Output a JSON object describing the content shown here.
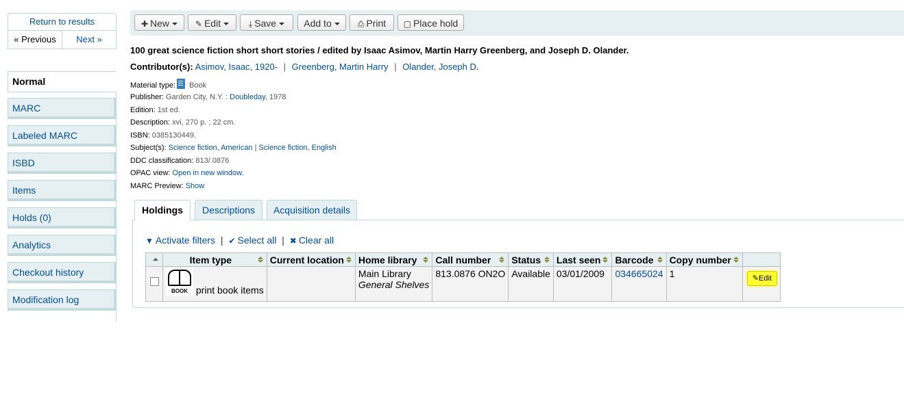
{
  "nav": {
    "return": "Return to results",
    "previous": "« Previous",
    "next": "Next »"
  },
  "sidebar": {
    "items": [
      {
        "label": "Normal"
      },
      {
        "label": "MARC"
      },
      {
        "label": "Labeled MARC"
      },
      {
        "label": "ISBD"
      },
      {
        "label": "Items"
      },
      {
        "label": "Holds (0)"
      },
      {
        "label": "Analytics"
      },
      {
        "label": "Checkout history"
      },
      {
        "label": "Modification log"
      }
    ]
  },
  "toolbar": {
    "new": "New",
    "edit": "Edit",
    "save": "Save",
    "add_to": "Add to",
    "print": "Print",
    "place_hold": "Place hold"
  },
  "record": {
    "title": "100 great science fiction short short stories / edited by Isaac Asimov, Martin Harry Greenberg, and Joseph D. Olander.",
    "contributors_label": "Contributor(s):",
    "contributors": [
      "Asimov, Isaac, 1920-",
      "Greenberg, Martin Harry",
      "Olander, Joseph D"
    ],
    "contributors_end": ".",
    "sep": "|",
    "material_type_label": "Material type:",
    "material_type": "Book",
    "publisher_label": "Publisher:",
    "publisher_place": "Garden City, N.Y. :",
    "publisher_name": "Doubleday",
    "publisher_year": ", 1978",
    "edition_label": "Edition:",
    "edition": "1st ed.",
    "description_label": "Description:",
    "description": "xvi, 270 p. ; 22 cm.",
    "isbn_label": "ISBN:",
    "isbn": "0385130449.",
    "subjects_label": "Subject(s):",
    "subject1a": "Science fiction",
    "subject1b": "American",
    "subject2a": "Science fiction",
    "subject2b": "English",
    "comma": ",",
    "ddc_label": "DDC classification:",
    "ddc": "813/.0876",
    "opac_label": "OPAC view:",
    "opac": "Open in new window.",
    "marc_preview_label": "MARC Preview:",
    "marc_preview": "Show"
  },
  "tabs": {
    "holdings": "Holdings",
    "descriptions": "Descriptions",
    "acquisition": "Acquisition details"
  },
  "filters": {
    "activate": "Activate filters",
    "select_all": "Select all",
    "clear_all": "Clear all",
    "pipe": "|"
  },
  "table": {
    "headers": [
      "Item type",
      "Current location",
      "Home library",
      "Call number",
      "Status",
      "Last seen",
      "Barcode",
      "Copy number"
    ],
    "row": {
      "item_type_icon_caption": "BOOK",
      "item_type": "print book items",
      "current_location": "",
      "home_library": "Main Library",
      "shelving": "General Shelves",
      "call_number": "813.0876 ON2O",
      "status": "Available",
      "last_seen": "03/01/2009",
      "barcode": "034665024",
      "copy_number": "1",
      "edit": "Edit"
    }
  }
}
